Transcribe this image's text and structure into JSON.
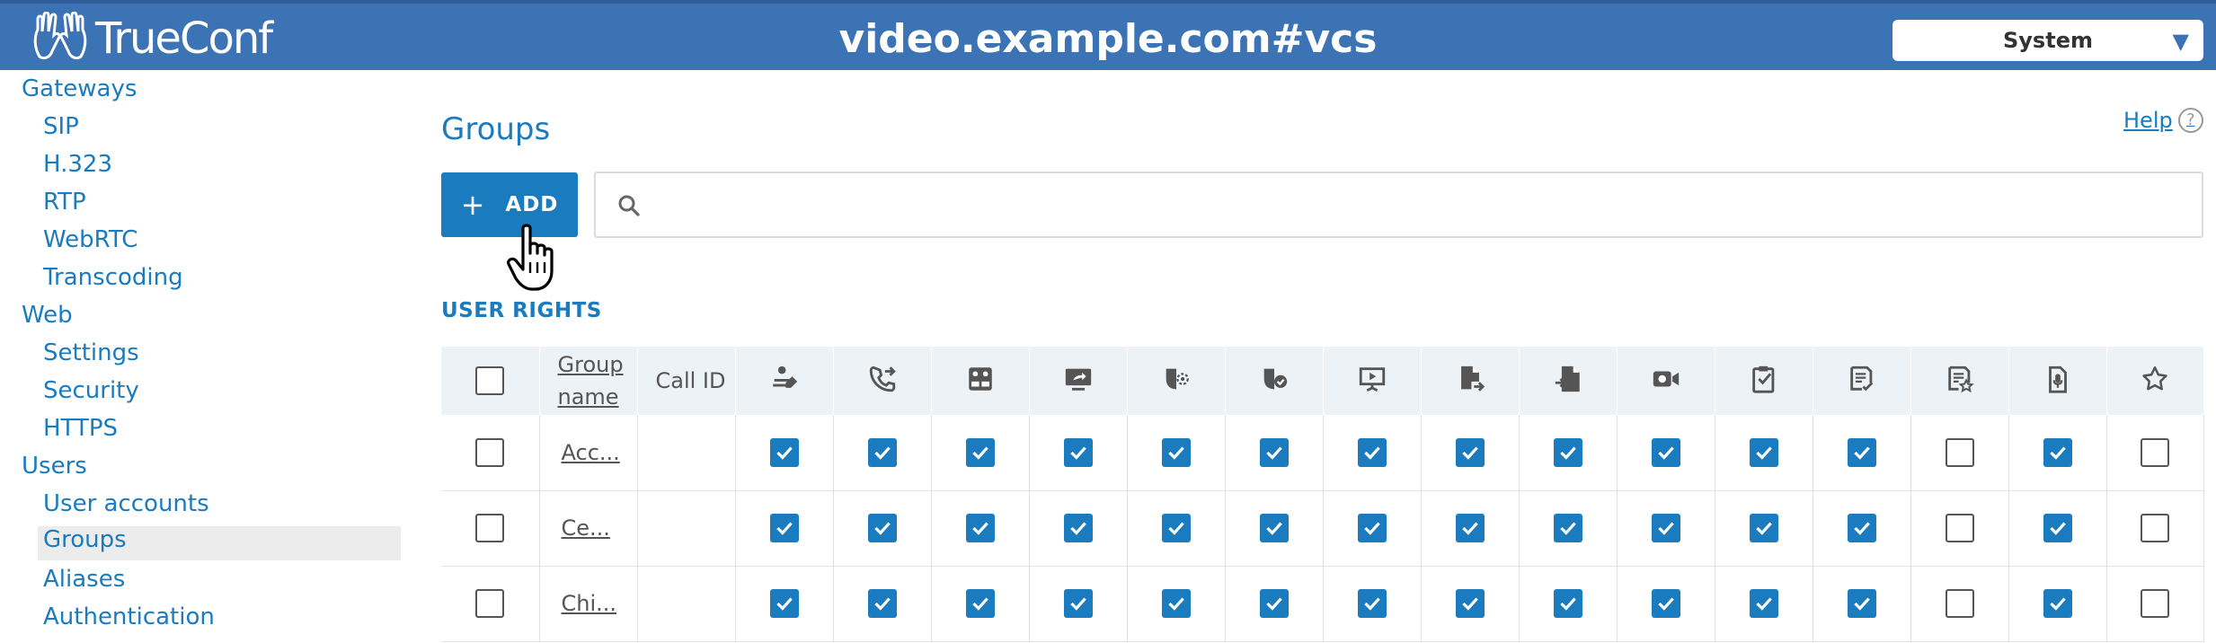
{
  "header": {
    "logo_text": "TrueConf",
    "site_title": "video.example.com#vcs",
    "select_value": "System"
  },
  "sidebar": {
    "items": [
      {
        "label": "Gateways",
        "level": 0
      },
      {
        "label": "SIP",
        "level": 1
      },
      {
        "label": "H.323",
        "level": 1
      },
      {
        "label": "RTP",
        "level": 1
      },
      {
        "label": "WebRTC",
        "level": 1
      },
      {
        "label": "Transcoding",
        "level": 1
      },
      {
        "label": "Web",
        "level": 0
      },
      {
        "label": "Settings",
        "level": 1
      },
      {
        "label": "Security",
        "level": 1
      },
      {
        "label": "HTTPS",
        "level": 1
      },
      {
        "label": "Users",
        "level": 0
      },
      {
        "label": "User accounts",
        "level": 1
      },
      {
        "label": "Groups",
        "level": 1,
        "active": true
      },
      {
        "label": "Aliases",
        "level": 1
      },
      {
        "label": "Authentication",
        "level": 1
      }
    ]
  },
  "main": {
    "title": "Groups",
    "help_label": "Help",
    "add_label": "ADD",
    "search_placeholder": "",
    "section_label": "USER RIGHTS"
  },
  "table": {
    "col_group_name": "Group name",
    "col_call_id": "Call ID",
    "right_icons": [
      "presenter-edit-icon",
      "call-transfer-icon",
      "video-layout-icon",
      "screen-share-icon",
      "remote-control-icon",
      "slide-show-icon",
      "presentation-icon",
      "file-send-icon",
      "file-receive-icon",
      "video-record-icon",
      "whiteboard-icon",
      "poll-create-icon",
      "poll-results-icon",
      "audio-record-icon",
      "favorite-star-icon"
    ],
    "rows": [
      {
        "name": "Acc...",
        "call_id": "",
        "rights": [
          true,
          true,
          true,
          true,
          true,
          true,
          true,
          true,
          true,
          true,
          true,
          true,
          false,
          true,
          false
        ]
      },
      {
        "name": "Ce...",
        "call_id": "",
        "rights": [
          true,
          true,
          true,
          true,
          true,
          true,
          true,
          true,
          true,
          true,
          true,
          true,
          false,
          true,
          false
        ]
      },
      {
        "name": "Chi...",
        "call_id": "",
        "rights": [
          true,
          true,
          true,
          true,
          true,
          true,
          true,
          true,
          true,
          true,
          true,
          true,
          false,
          true,
          false
        ]
      }
    ]
  },
  "colors": {
    "header_bg": "#3b73b5",
    "accent": "#1a7bbf",
    "table_header_bg": "#edf2f6"
  }
}
